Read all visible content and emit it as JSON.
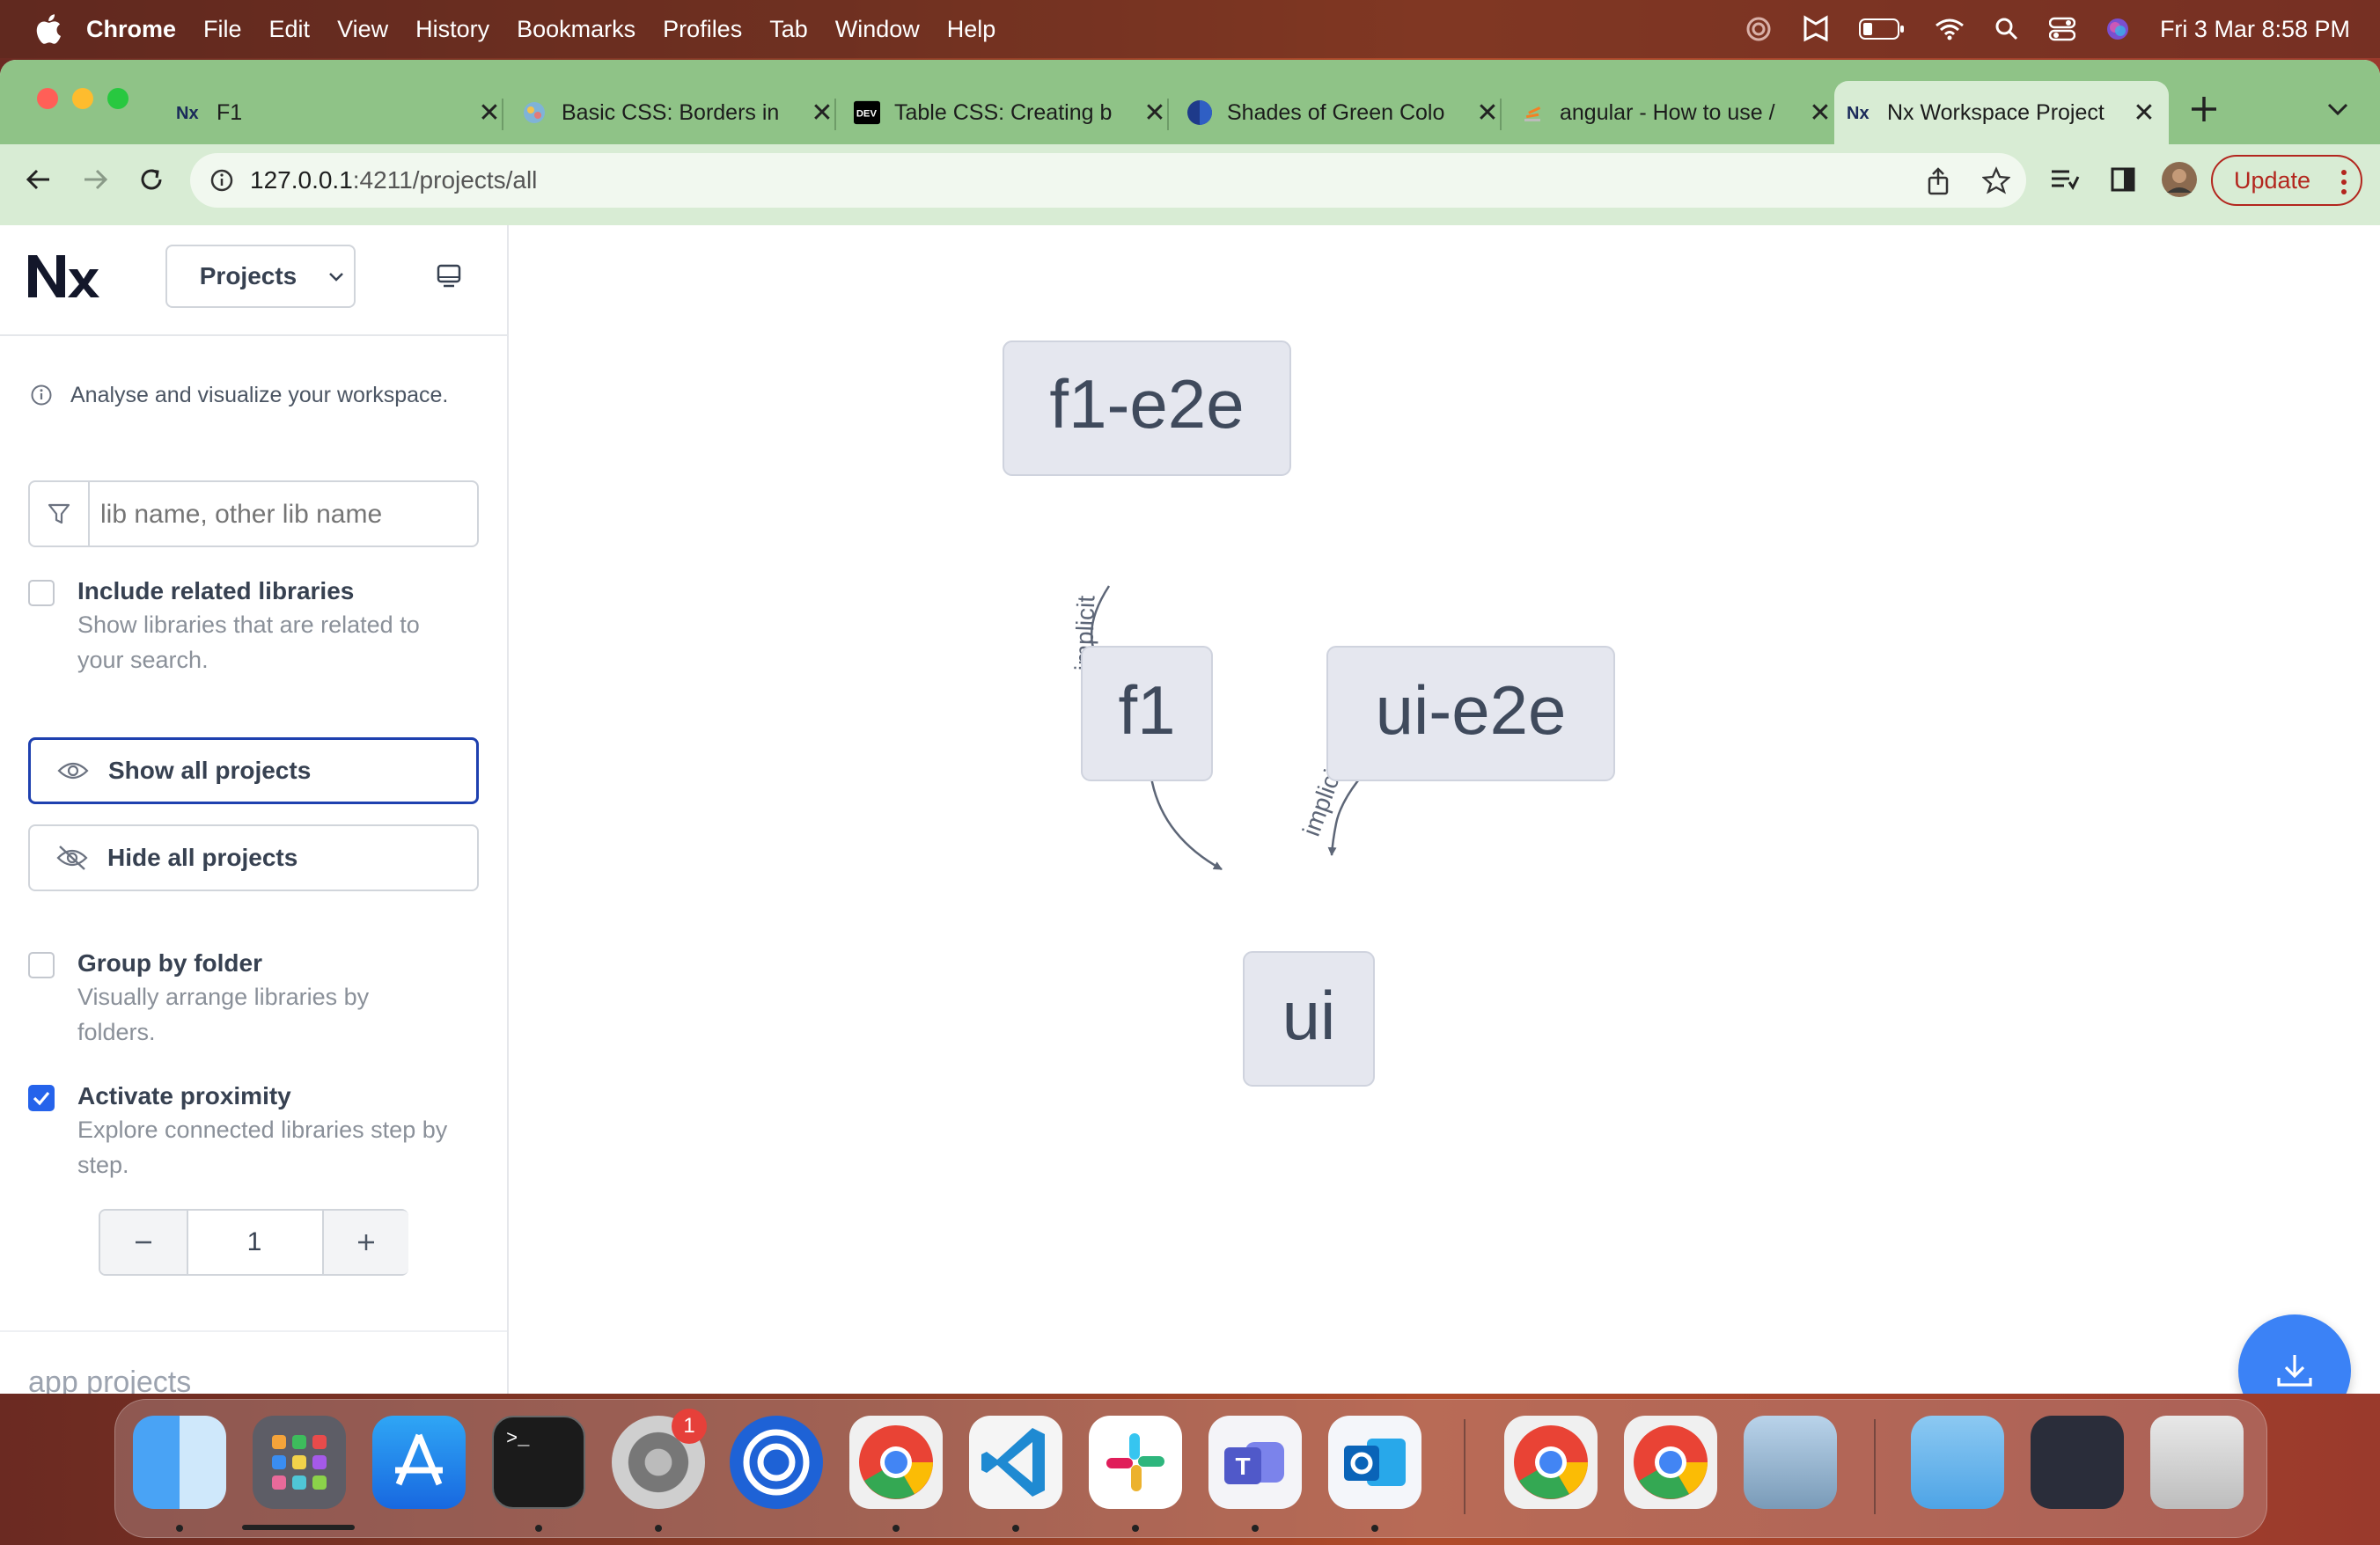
{
  "menubar": {
    "app": "Chrome",
    "items": [
      "File",
      "Edit",
      "View",
      "History",
      "Bookmarks",
      "Profiles",
      "Tab",
      "Window",
      "Help"
    ],
    "clock": "Fri 3 Mar  8:58 PM"
  },
  "tabs": [
    {
      "title": "F1",
      "favicon": "nx-logo-icon"
    },
    {
      "title": "Basic CSS: Borders in",
      "favicon": "globe-icon"
    },
    {
      "title": "Table CSS: Creating b",
      "favicon": "dev-logo-icon"
    },
    {
      "title": "Shades of Green Colo",
      "favicon": "color-circle-icon"
    },
    {
      "title": "angular - How to use /",
      "favicon": "stackoverflow-icon"
    },
    {
      "title": "Nx Workspace Project",
      "favicon": "nx-logo-icon",
      "active": true
    }
  ],
  "toolbar": {
    "url_host": "127.0.0.1",
    "url_rest": ":4211/projects/all",
    "update_label": "Update"
  },
  "sidebar": {
    "view_select": "Projects",
    "info_text": "Analyse and visualize your workspace.",
    "search_placeholder": "lib name, other lib name",
    "include_related": {
      "title": "Include related libraries",
      "desc_line1": "Show libraries that are related to",
      "desc_line2": "your search.",
      "checked": false
    },
    "show_all_label": "Show all projects",
    "hide_all_label": "Hide all projects",
    "group_by_folder": {
      "title": "Group by folder",
      "desc_line1": "Visually arrange libraries by",
      "desc_line2": "folders.",
      "checked": false
    },
    "activate_proximity": {
      "title": "Activate proximity",
      "desc_line1": "Explore connected libraries step by",
      "desc_line2": "step.",
      "checked": true
    },
    "proximity_value": "1",
    "section_label": "app projects"
  },
  "graph": {
    "nodes": [
      "f1-e2e",
      "f1",
      "ui-e2e",
      "ui"
    ],
    "edges": [
      {
        "from": "f1-e2e",
        "to": "f1",
        "label": "implicit"
      },
      {
        "from": "ui-e2e",
        "to": "ui",
        "label": "implicit"
      },
      {
        "from": "f1",
        "to": "ui",
        "label": ""
      }
    ],
    "node_fill": "#e5e7ef",
    "node_text_color": "#3f4a5c"
  },
  "colors": {
    "tabstrip": "#8fc387",
    "toolbar": "#d8ecd4",
    "accent": "#2563eb",
    "fab": "#3b82f6",
    "update": "#b3261e"
  },
  "dock": {
    "apps": [
      "finder-icon",
      "launchpad-icon",
      "app-store-icon",
      "terminal-icon",
      "system-settings-icon",
      "pock-icon",
      "chrome-icon",
      "vscode-icon",
      "slack-icon",
      "teams-icon",
      "outlook-icon",
      "chrome-icon",
      "chrome-icon",
      "preview-icon",
      "folder-icon",
      "screenshot-icon",
      "trash-icon"
    ],
    "settings_badge": "1"
  }
}
